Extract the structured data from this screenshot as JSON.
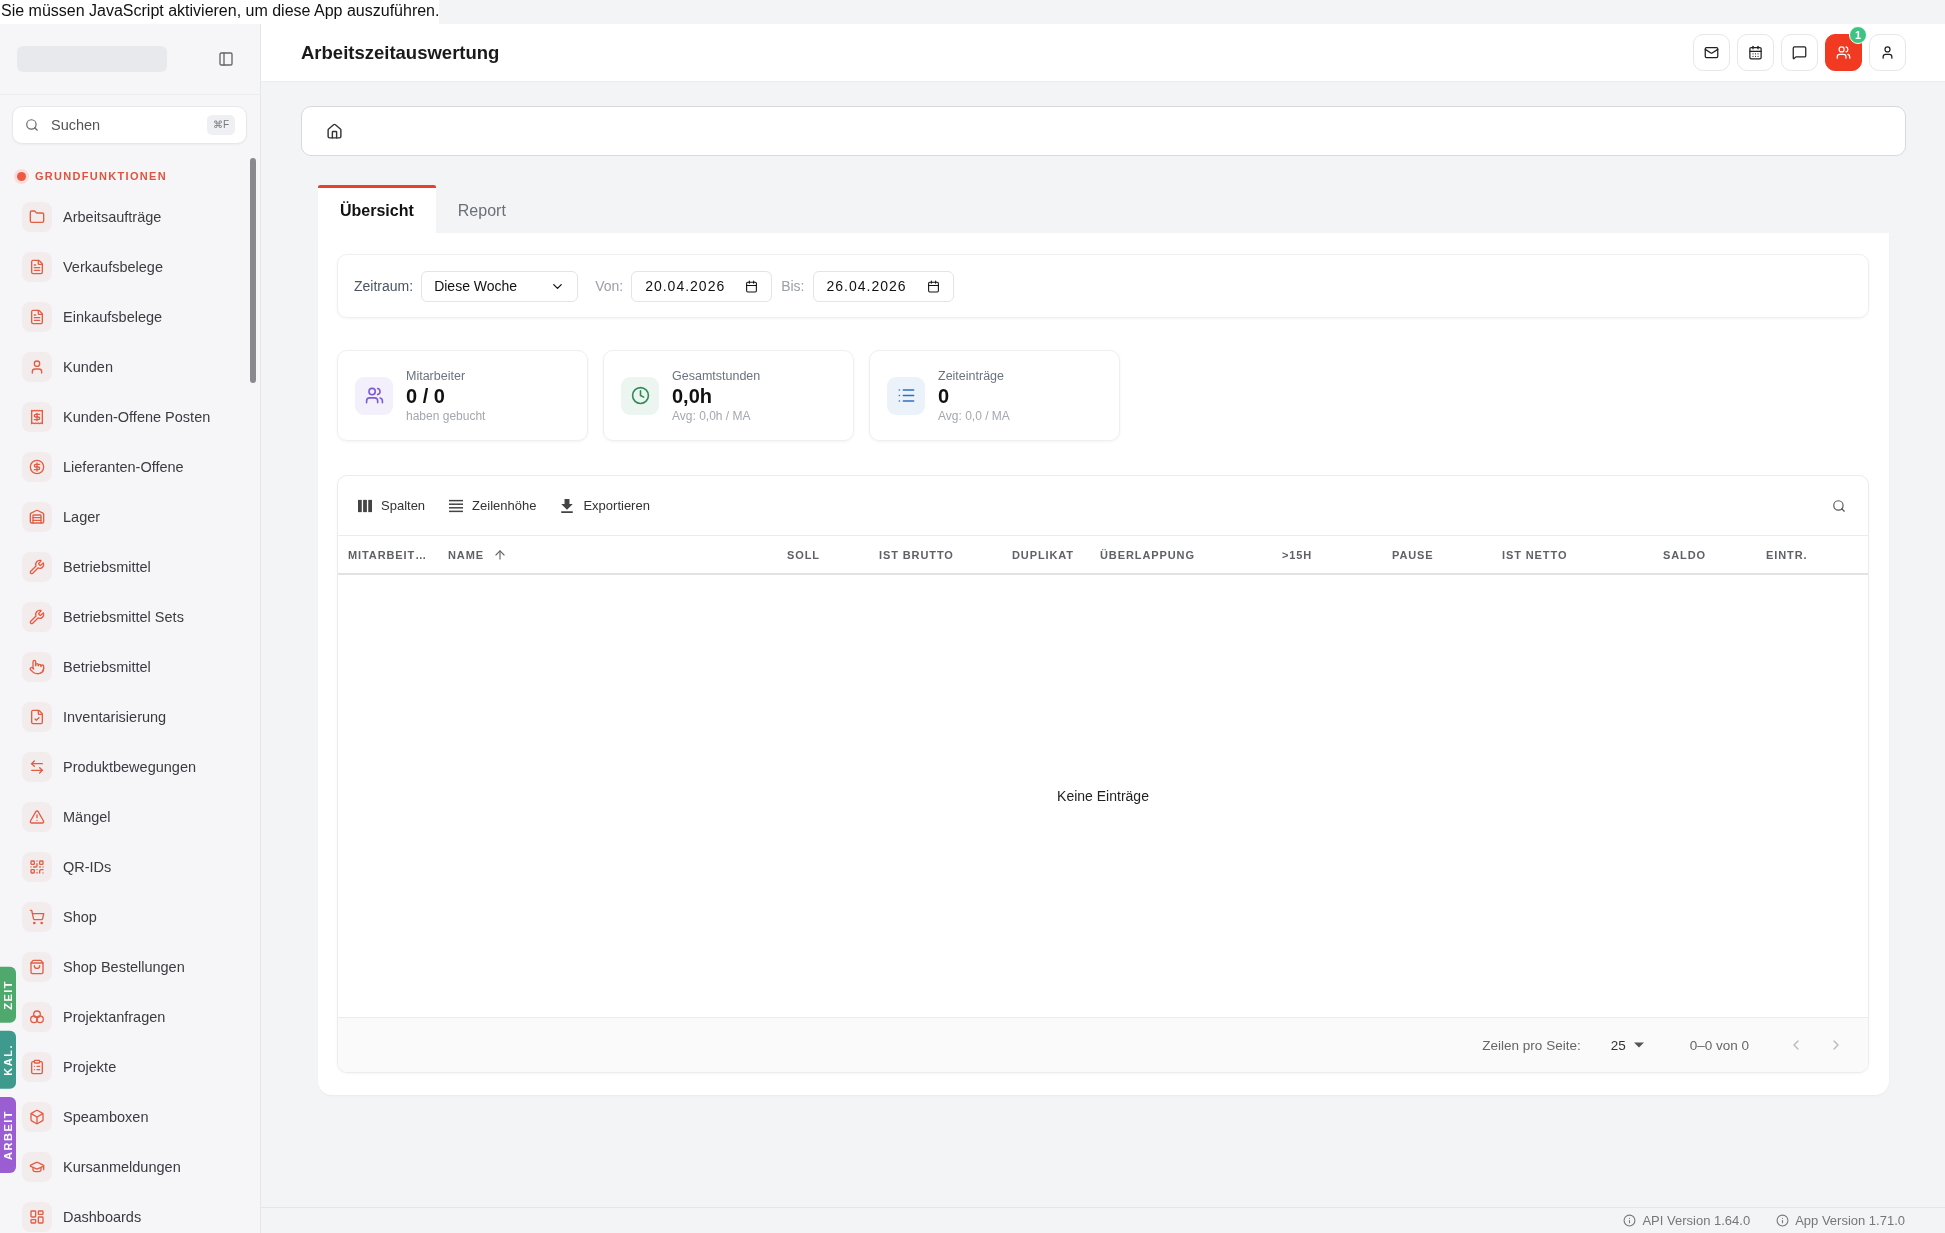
{
  "notice": "Sie müssen JavaScript aktivieren, um diese App auszuführen.",
  "sidebar": {
    "search": {
      "placeholder": "Suchen",
      "shortcut": "⌘F"
    },
    "section": "GRUNDFUNKTIONEN",
    "items": [
      "Arbeitsaufträge",
      "Verkaufsbelege",
      "Einkaufsbelege",
      "Kunden",
      "Kunden-Offene Posten",
      "Lieferanten-Offene",
      "Lager",
      "Betriebsmittel",
      "Betriebsmittel Sets",
      "Betriebsmittel",
      "Inventarisierung",
      "Produktbewegungen",
      "Mängel",
      "QR-IDs",
      "Shop",
      "Shop Bestellungen",
      "Projektanfragen",
      "Projekte",
      "Speamboxen",
      "Kursanmeldungen",
      "Dashboards"
    ],
    "side_tabs": [
      {
        "label": "ZEIT",
        "color": "#4fa96c"
      },
      {
        "label": "KAL.",
        "color": "#3e9a8c"
      },
      {
        "label": "ARBEIT",
        "color": "#9b5ed2"
      }
    ]
  },
  "header": {
    "title": "Arbeitszeitauswertung",
    "actions": [
      {
        "active": false
      },
      {
        "active": false
      },
      {
        "active": false
      },
      {
        "active": true,
        "badge": "1"
      },
      {
        "active": false
      }
    ]
  },
  "tabs": [
    {
      "label": "Übersicht",
      "selected": true
    },
    {
      "label": "Report",
      "selected": false
    }
  ],
  "filters": {
    "period_label": "Zeitraum:",
    "period": "Diese Woche",
    "from_label": "Von:",
    "from": "20.04.2026",
    "to_label": "Bis:",
    "to": "26.04.2026"
  },
  "stats": [
    {
      "label": "Mitarbeiter",
      "value": "0 / 0",
      "note": "haben gebucht",
      "color": "#7c5bd6"
    },
    {
      "label": "Gesamtstunden",
      "value": "0,0h",
      "note": "Avg: 0,0h / MA",
      "color": "#2e8b57"
    },
    {
      "label": "Zeiteinträge",
      "value": "0",
      "note": "Avg: 0,0 / MA",
      "color": "#2f6fc4"
    }
  ],
  "table": {
    "toolbar": [
      "Spalten",
      "Zeilenhöhe",
      "Exportieren"
    ],
    "columns": [
      {
        "label": "MITARBEIT…",
        "sorted": false
      },
      {
        "label": "NAME",
        "sorted": true
      },
      {
        "label": "SOLL",
        "sorted": false
      },
      {
        "label": "IST BRUTTO",
        "sorted": false
      },
      {
        "label": "DUPLIKAT",
        "sorted": false
      },
      {
        "label": "ÜBERLAPPUNG",
        "sorted": false
      },
      {
        "label": ">15H",
        "sorted": false
      },
      {
        "label": "PAUSE",
        "sorted": false
      },
      {
        "label": "IST NETTO",
        "sorted": false
      },
      {
        "label": "SALDO",
        "sorted": false
      },
      {
        "label": "EINTR.",
        "sorted": false
      }
    ],
    "empty": "Keine Einträge",
    "pagination": {
      "rows_label": "Zeilen pro Seite:",
      "rows": "25",
      "range": "0–0 von 0",
      "prev": {
        "disabled": true
      },
      "next": {
        "disabled": true
      }
    }
  },
  "footer": {
    "api_version": "API Version 1.64.0",
    "app_version": "App Version 1.71.0"
  }
}
